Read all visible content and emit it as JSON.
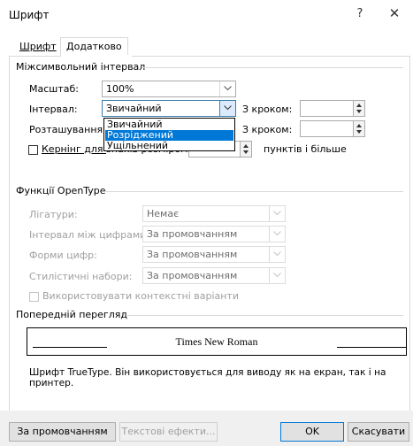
{
  "window": {
    "title": "Шрифт",
    "help": "?",
    "close": "✕"
  },
  "tabs": [
    {
      "label": "Шрифт"
    },
    {
      "label": "Додатково"
    }
  ],
  "spacing": {
    "group_title": "Міжсимвольний інтервал",
    "scale_label": "Масштаб:",
    "scale_value": "100%",
    "interval_label": "Інтервал:",
    "interval_value": "Звичайний",
    "interval_step_label": "З кроком:",
    "interval_step_value": "",
    "position_label": "Розташування:",
    "position_step_label": "З кроком:",
    "position_step_value": "",
    "kerning_label_a": "Кернінг для ",
    "kerning_label_b": "знаків розміром",
    "kerning_value": "",
    "kerning_suffix": "пунктів і більше",
    "kerning_checked": false,
    "interval_options": [
      "Звичайний",
      "Розріджений",
      "Ущільнений"
    ],
    "interval_highlighted": "Розріджений"
  },
  "opentype": {
    "group_title": "Функції OpenType",
    "ligatures_label": "Лігатури:",
    "ligatures_value": "Немає",
    "numspacing_label": "Інтервал між цифрами:",
    "numspacing_value": "За промовчанням",
    "numforms_label": "Форми цифр:",
    "numforms_value": "За промовчанням",
    "stylistic_label": "Стилістичні набори:",
    "stylistic_value": "За промовчанням",
    "contextual_label": "Використовувати контекстні варіанти",
    "contextual_checked": false
  },
  "preview": {
    "group_title": "Попередній перегляд",
    "sample": "Times New Roman",
    "note": "Шрифт TrueType. Він використовується для виводу як на екран, так і на принтер."
  },
  "buttons": {
    "default": "За промовчанням",
    "effects": "Текстові ефекти...",
    "ok": "OK",
    "cancel": "Скасувати"
  }
}
